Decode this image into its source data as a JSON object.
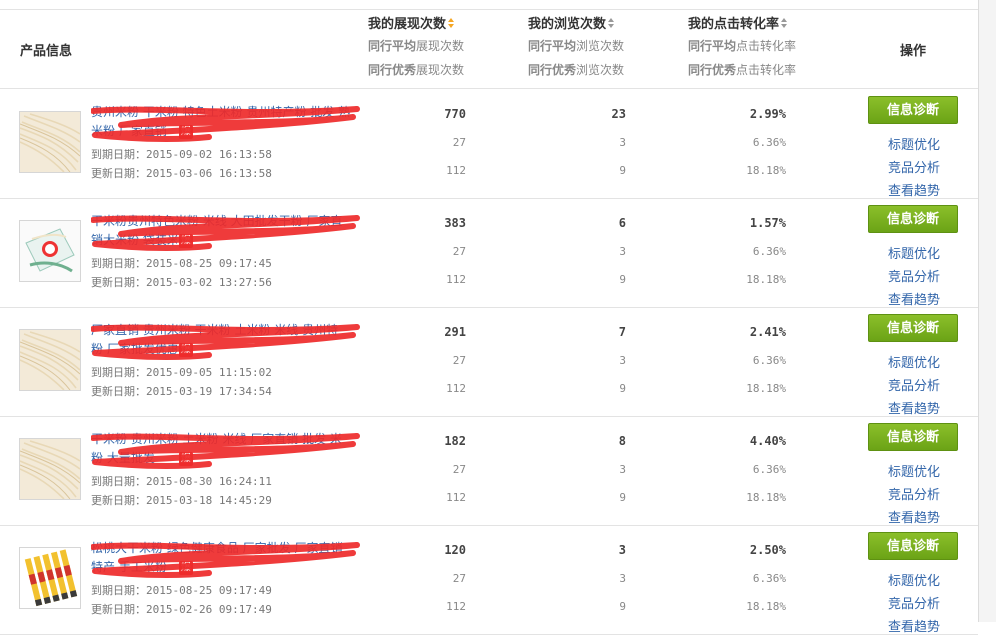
{
  "header": {
    "product_info": "产品信息",
    "operation": "操作",
    "columns": [
      {
        "main": "我的展现次数",
        "avg_prefix": "同行平均",
        "avg_suffix": "展现次数",
        "best_prefix": "同行优秀",
        "best_suffix": "展现次数",
        "sort_active": true
      },
      {
        "main": "我的浏览次数",
        "avg_prefix": "同行平均",
        "avg_suffix": "浏览次数",
        "best_prefix": "同行优秀",
        "best_suffix": "浏览次数",
        "sort_active": false
      },
      {
        "main": "我的点击转化率",
        "avg_prefix": "同行平均",
        "avg_suffix": "点击转化率",
        "best_prefix": "同行优秀",
        "best_suffix": "点击转化率",
        "sort_active": false
      }
    ]
  },
  "actions": {
    "diagnose": "信息诊断",
    "title_opt": "标题优化",
    "competitor": "竞品分析",
    "trend": "查看趋势"
  },
  "rows": [
    {
      "title_line1": "贵州米粉 干米粉 特色土米粉 贵州特产粉 批发 熟",
      "title_line2": "米粉 厂家直销",
      "hot": "爆",
      "expire_label": "到期日期：",
      "expire": "2015-09-02 16:13:58",
      "update_label": "更新日期：",
      "update": "2015-03-06 16:13:58",
      "impressions": "770",
      "impressions_avg": "27",
      "impressions_best": "112",
      "views": "23",
      "views_avg": "3",
      "views_best": "9",
      "ctr": "2.99%",
      "ctr_avg": "6.36%",
      "ctr_best": "18.18%",
      "thumb": "noodles"
    },
    {
      "title_line1": "干米粉贵州特色米粉 米线 大田批发干粉 厂家直",
      "title_line2": "销大米粉 袋装米粉",
      "hot": "爆",
      "expire_label": "到期日期：",
      "expire": "2015-08-25 09:17:45",
      "update_label": "更新日期：",
      "update": "2015-03-02 13:27:56",
      "impressions": "383",
      "impressions_avg": "27",
      "impressions_best": "112",
      "views": "6",
      "views_avg": "3",
      "views_best": "9",
      "ctr": "1.57%",
      "ctr_avg": "6.36%",
      "ctr_best": "18.18%",
      "thumb": "bag"
    },
    {
      "title_line1": "厂家直销 贵州米粉 干米粉 土米粉 米线 贵州特",
      "title_line2": "粉 厂家批发优惠 米粉",
      "hot": "爆",
      "expire_label": "到期日期：",
      "expire": "2015-09-05 11:15:02",
      "update_label": "更新日期：",
      "update": "2015-03-19 17:34:54",
      "impressions": "291",
      "impressions_avg": "27",
      "impressions_best": "112",
      "views": "7",
      "views_avg": "3",
      "views_best": "9",
      "ctr": "2.41%",
      "ctr_avg": "6.36%",
      "ctr_best": "18.18%",
      "thumb": "noodles"
    },
    {
      "title_line1": "干米粉 贵州米粉 土米粉 米线 厂家直销 批发 米",
      "title_line2": "粉 大量批发",
      "hot": "爆",
      "expire_label": "到期日期：",
      "expire": "2015-08-30 16:24:11",
      "update_label": "更新日期：",
      "update": "2015-03-18 14:45:29",
      "impressions": "182",
      "impressions_avg": "27",
      "impressions_best": "112",
      "views": "8",
      "views_avg": "3",
      "views_best": "9",
      "ctr": "4.40%",
      "ctr_avg": "6.36%",
      "ctr_best": "18.18%",
      "thumb": "noodles"
    },
    {
      "title_line1": "松桃大干米粉 绿色健康食品 厂家批发 厂家直销",
      "title_line2": "特产 手工米粉",
      "hot": "爆",
      "expire_label": "到期日期：",
      "expire": "2015-08-25 09:17:49",
      "update_label": "更新日期：",
      "update": "2015-02-26 09:17:49",
      "impressions": "120",
      "impressions_avg": "27",
      "impressions_best": "112",
      "views": "3",
      "views_avg": "3",
      "views_best": "9",
      "ctr": "2.50%",
      "ctr_avg": "6.36%",
      "ctr_best": "18.18%",
      "thumb": "sticks"
    }
  ]
}
